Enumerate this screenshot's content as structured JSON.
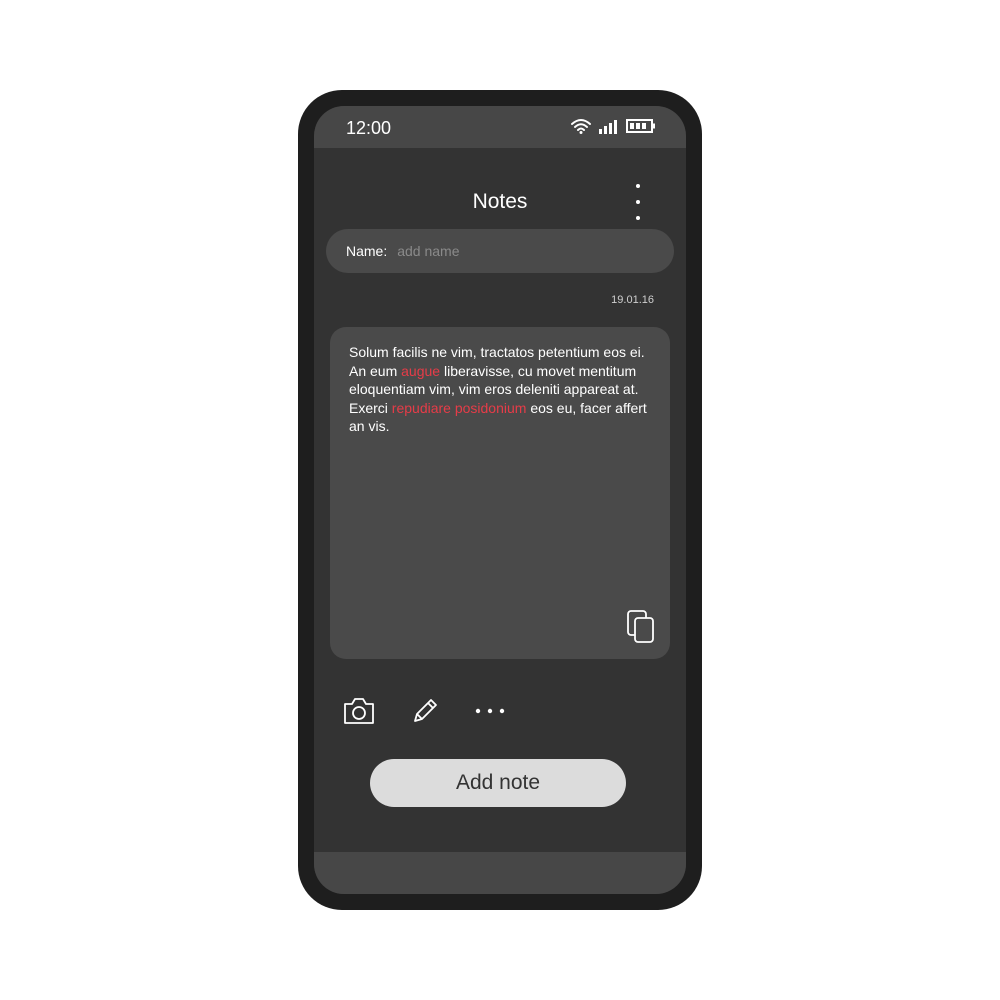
{
  "status_bar": {
    "time": "12:00",
    "icons": [
      "wifi-icon",
      "signal-icon",
      "battery-icon"
    ]
  },
  "header": {
    "title": "Notes",
    "menu_icon": "more-vertical-icon"
  },
  "name_field": {
    "label": "Name:",
    "placeholder": "add name",
    "value": ""
  },
  "note": {
    "date": "19.01.16",
    "segments": [
      {
        "text": "Solum facilis ne vim, tractatos petentium eos ei. An eum ",
        "highlight": false
      },
      {
        "text": "augue",
        "highlight": true
      },
      {
        "text": " liberavisse, cu movet mentitum eloquentiam vim, vim eros deleniti appareat at. Exerci ",
        "highlight": false
      },
      {
        "text": "repudiare posidonium",
        "highlight": true
      },
      {
        "text": " eos eu, facer affert an vis.",
        "highlight": false
      }
    ],
    "copy_icon": "copy-icon"
  },
  "toolbar": {
    "icons": [
      "camera-icon",
      "pencil-icon",
      "more-horizontal-icon"
    ]
  },
  "add_note_button": {
    "label": "Add note"
  },
  "colors": {
    "phone_frame": "#1e1e1e",
    "screen_background": "#333333",
    "card_background": "#4a4a4a",
    "highlight": "#e63c48",
    "button_background": "#dcdcdc"
  }
}
